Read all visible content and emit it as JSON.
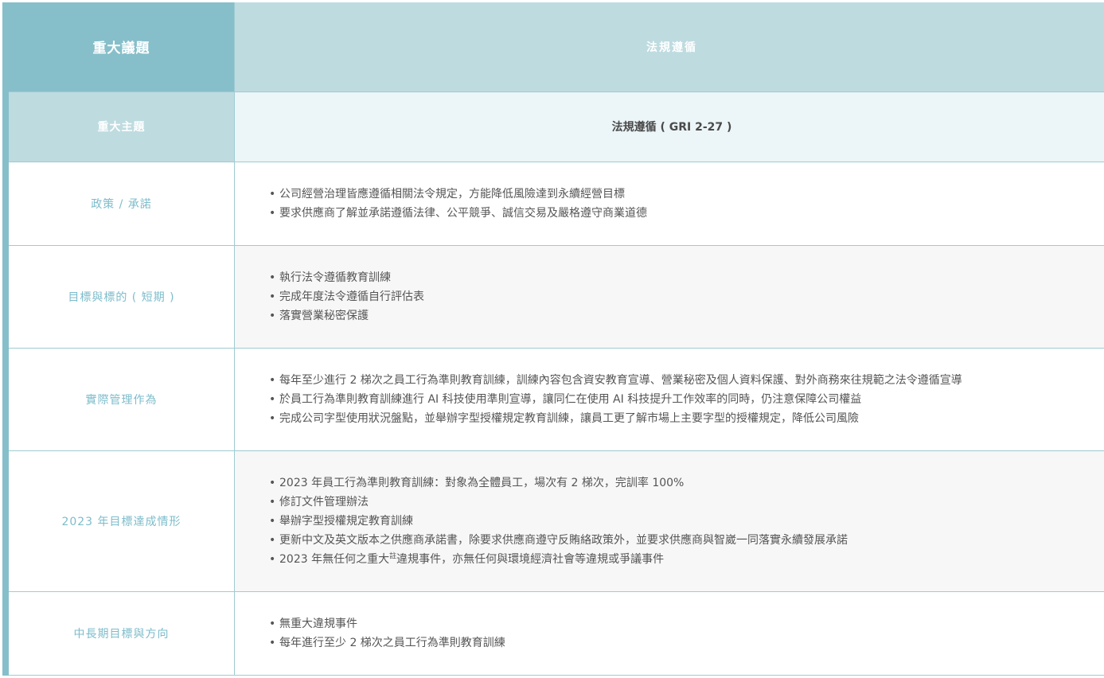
{
  "header": {
    "issue_label": "重大議題",
    "issue_value": "法規遵循"
  },
  "theme": {
    "label": "重大主題",
    "value": "法規遵循 ( GRI 2-27 )"
  },
  "policy": {
    "label": "政策 / 承諾",
    "items": [
      "公司經營治理皆應遵循相關法令規定，方能降低風險達到永續經營目標",
      "要求供應商了解並承諾遵循法律、公平競爭、誠信交易及嚴格遵守商業道德"
    ]
  },
  "short_term": {
    "label": "目標與標的 ( 短期 )",
    "items": [
      "執行法令遵循教育訓練",
      "完成年度法令遵循自行評估表",
      "落實營業秘密保護"
    ]
  },
  "actions": {
    "label": "實際管理作為",
    "items": [
      "每年至少進行 2 梯次之員工行為準則教育訓練，訓練內容包含資安教育宣導、營業秘密及個人資料保護、對外商務來往規範之法令遵循宣導",
      "於員工行為準則教育訓練進行 AI 科技使用準則宣導，讓同仁在使用 AI 科技提升工作效率的同時，仍注意保障公司權益",
      "完成公司字型使用狀況盤點，並舉辦字型授權規定教育訓練，讓員工更了解市場上主要字型的授權規定，降低公司風險"
    ]
  },
  "achievement": {
    "label": "2023 年目標達成情形",
    "items": [
      "2023 年員工行為準則教育訓練：對象為全體員工，場次有 2 梯次，完訓率 100%",
      "修訂文件管理辦法",
      "舉辦字型授權規定教育訓練",
      "更新中文及英文版本之供應商承諾書，除要求供應商遵守反賄絡政策外，並要求供應商與智崴一同落實永續發展承諾"
    ],
    "last_item_pre": "2023 年無任何之重大",
    "last_item_note": "註",
    "last_item_post": "違規事件，亦無任何與環境經濟社會等違規或爭議事件"
  },
  "long_term": {
    "label": "中長期目標與方向",
    "items": [
      "無重大違規事件",
      "每年進行至少 2 梯次之員工行為準則教育訓練"
    ]
  }
}
